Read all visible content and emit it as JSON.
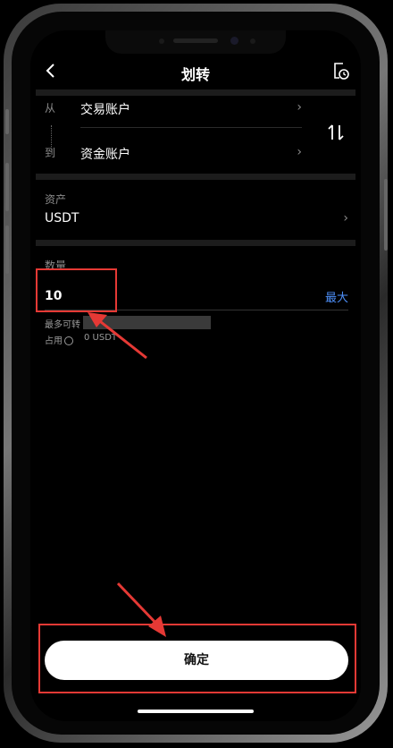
{
  "nav": {
    "title": "划转",
    "back_icon": "chevron-left-icon",
    "history_icon": "history-icon"
  },
  "transfer": {
    "from_label": "从",
    "to_label": "到",
    "from_account": "交易账户",
    "to_account": "资金账户",
    "swap_icon": "swap-icon"
  },
  "asset": {
    "label": "资产",
    "value": "USDT"
  },
  "amount": {
    "label": "数量",
    "value": "10",
    "max_label": "最大"
  },
  "info": {
    "max_transferable_label": "最多可转",
    "occupied_label": "占用",
    "occupied_value": "0 USDT"
  },
  "confirm_label": "确定",
  "colors": {
    "accent": "#4d8ef7",
    "annotation": "#e53935"
  }
}
